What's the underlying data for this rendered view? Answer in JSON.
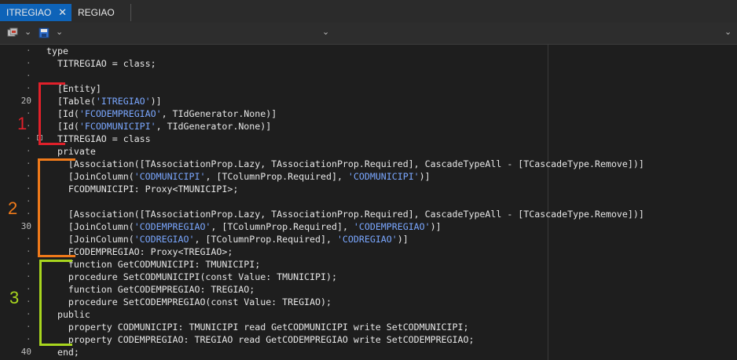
{
  "tabs": [
    {
      "label": "ITREGIAO",
      "active": true,
      "close": "✕"
    },
    {
      "label": "REGIAO",
      "active": false
    }
  ],
  "toolbar": {
    "icons": [
      "component-icon",
      "chevron-down-icon",
      "save-icon",
      "chevron-down-icon"
    ],
    "dropdown_left": "⌄",
    "dropdown_right": "⌄"
  },
  "gutter": {
    "numbers": [
      {
        "line": 4,
        "text": "20"
      },
      {
        "line": 14,
        "text": "30"
      },
      {
        "line": 24,
        "text": "40"
      }
    ]
  },
  "code": [
    "type",
    "  TITREGIAO = class;",
    "",
    "  [Entity]",
    "  [Table('ITREGIAO')]",
    "  [Id('FCODEMPREGIAO', TIdGenerator.None)]",
    "  [Id('FCODMUNICIPI', TIdGenerator.None)]",
    "  TITREGIAO = class",
    "  private",
    "    [Association([TAssociationProp.Lazy, TAssociationProp.Required], CascadeTypeAll - [TCascadeType.Remove])]",
    "    [JoinColumn('CODMUNICIPI', [TColumnProp.Required], 'CODMUNICIPI')]",
    "    FCODMUNICIPI: Proxy<TMUNICIPI>;",
    "",
    "    [Association([TAssociationProp.Lazy, TAssociationProp.Required], CascadeTypeAll - [TCascadeType.Remove])]",
    "    [JoinColumn('CODEMPREGIAO', [TColumnProp.Required], 'CODEMPREGIAO')]",
    "    [JoinColumn('CODREGIAO', [TColumnProp.Required], 'CODREGIAO')]",
    "    FCODEMPREGIAO: Proxy<TREGIAO>;",
    "    function GetCODMUNICIPI: TMUNICIPI;",
    "    procedure SetCODMUNICIPI(const Value: TMUNICIPI);",
    "    function GetCODEMPREGIAO: TREGIAO;",
    "    procedure SetCODEMPREGIAO(const Value: TREGIAO);",
    "  public",
    "    property CODMUNICIPI: TMUNICIPI read GetCODMUNICIPI write SetCODMUNICIPI;",
    "    property CODEMPREGIAO: TREGIAO read GetCODEMPREGIAO write SetCODEMPREGIAO;",
    "  end;"
  ],
  "annotations": [
    {
      "label": "1",
      "color": "#e0202a"
    },
    {
      "label": "2",
      "color": "#f07a1a"
    },
    {
      "label": "3",
      "color": "#a8d61e"
    }
  ]
}
